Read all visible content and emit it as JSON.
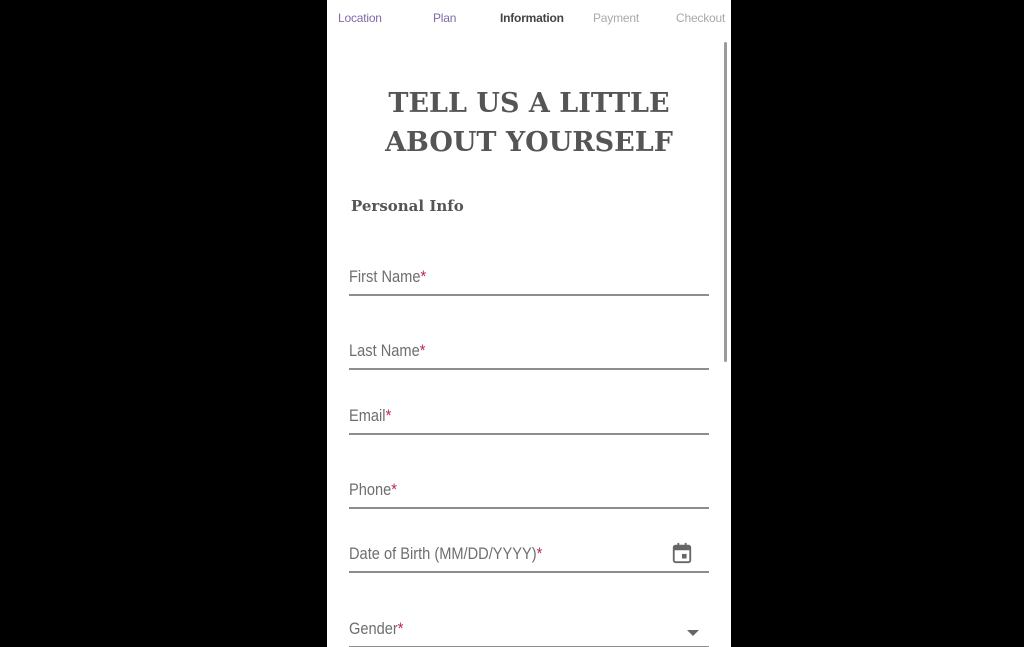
{
  "stepper": {
    "steps": [
      {
        "label": "Location",
        "state": "done"
      },
      {
        "label": "Plan",
        "state": "done"
      },
      {
        "label": "Information",
        "state": "active"
      },
      {
        "label": "Payment",
        "state": "todo"
      },
      {
        "label": "Checkout",
        "state": "todo"
      }
    ]
  },
  "page": {
    "title_line1": "TELL US A LITTLE",
    "title_line2": "ABOUT YOURSELF",
    "section_title": "Personal Info"
  },
  "form": {
    "required_marker": "*",
    "fields": [
      {
        "label": "First Name",
        "value": "",
        "required": true
      },
      {
        "label": "Last Name",
        "value": "",
        "required": true
      },
      {
        "label": "Email",
        "value": "",
        "required": true
      },
      {
        "label": "Phone",
        "value": "",
        "required": true
      },
      {
        "label": "Date of Birth (MM/DD/YYYY)",
        "value": "",
        "required": true,
        "icon": "calendar-icon"
      },
      {
        "label": "Gender",
        "value": "",
        "required": true,
        "icon": "dropdown-caret-icon"
      }
    ]
  },
  "colors": {
    "step_done": "#7e6aa8",
    "step_active": "#444444",
    "step_todo": "#a9a9a9",
    "required": "#c0284b",
    "heading": "#555555"
  }
}
